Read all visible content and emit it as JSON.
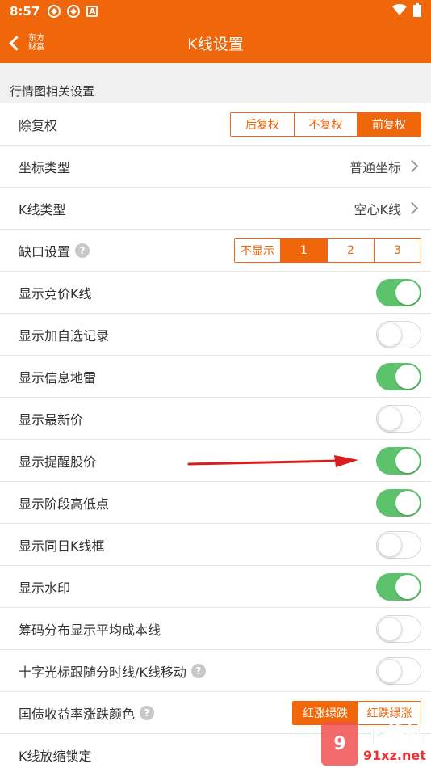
{
  "status_bar": {
    "time": "8:57",
    "icons": [
      "app-notification-icon",
      "app-notification-icon",
      "a-badge-icon"
    ],
    "badge_letter": "A",
    "right_icons": [
      "wifi-icon",
      "battery-icon"
    ]
  },
  "nav": {
    "back_logo": "东方财富",
    "title": "K线设置"
  },
  "section": {
    "title": "行情图相关设置"
  },
  "rows": {
    "fuquan": {
      "label": "除复权",
      "options": [
        "后复权",
        "不复权",
        "前复权"
      ],
      "selected": 2
    },
    "zuobiao": {
      "label": "坐标类型",
      "value": "普通坐标"
    },
    "kxian_type": {
      "label": "K线类型",
      "value": "空心K线"
    },
    "quekou": {
      "label": "缺口设置",
      "options": [
        "不显示",
        "1",
        "2",
        "3"
      ],
      "selected": 1
    },
    "toggles": [
      {
        "label": "显示竞价K线",
        "on": true
      },
      {
        "label": "显示加自选记录",
        "on": false
      },
      {
        "label": "显示信息地雷",
        "on": true
      },
      {
        "label": "显示最新价",
        "on": false
      },
      {
        "label": "显示提醒股价",
        "on": true
      },
      {
        "label": "显示阶段高低点",
        "on": true
      },
      {
        "label": "显示同日K线框",
        "on": false
      },
      {
        "label": "显示水印",
        "on": true
      },
      {
        "label": "筹码分布显示平均成本线",
        "on": false
      },
      {
        "label": "十字光标跟随分时线/K线移动",
        "on": false,
        "help": true
      }
    ],
    "guozhai": {
      "label": "国债收益率涨跌颜色",
      "options": [
        "红涨绿跌",
        "红跌绿涨"
      ],
      "selected": 0
    },
    "suofang": {
      "label": "K线放缩锁定"
    }
  },
  "watermark": {
    "badge": "9",
    "big": "下载站",
    "small": "91xz.net"
  },
  "colors": {
    "accent": "#f0660a",
    "toggle_on": "#5cc26c",
    "annotation_arrow": "#d81e1e"
  }
}
